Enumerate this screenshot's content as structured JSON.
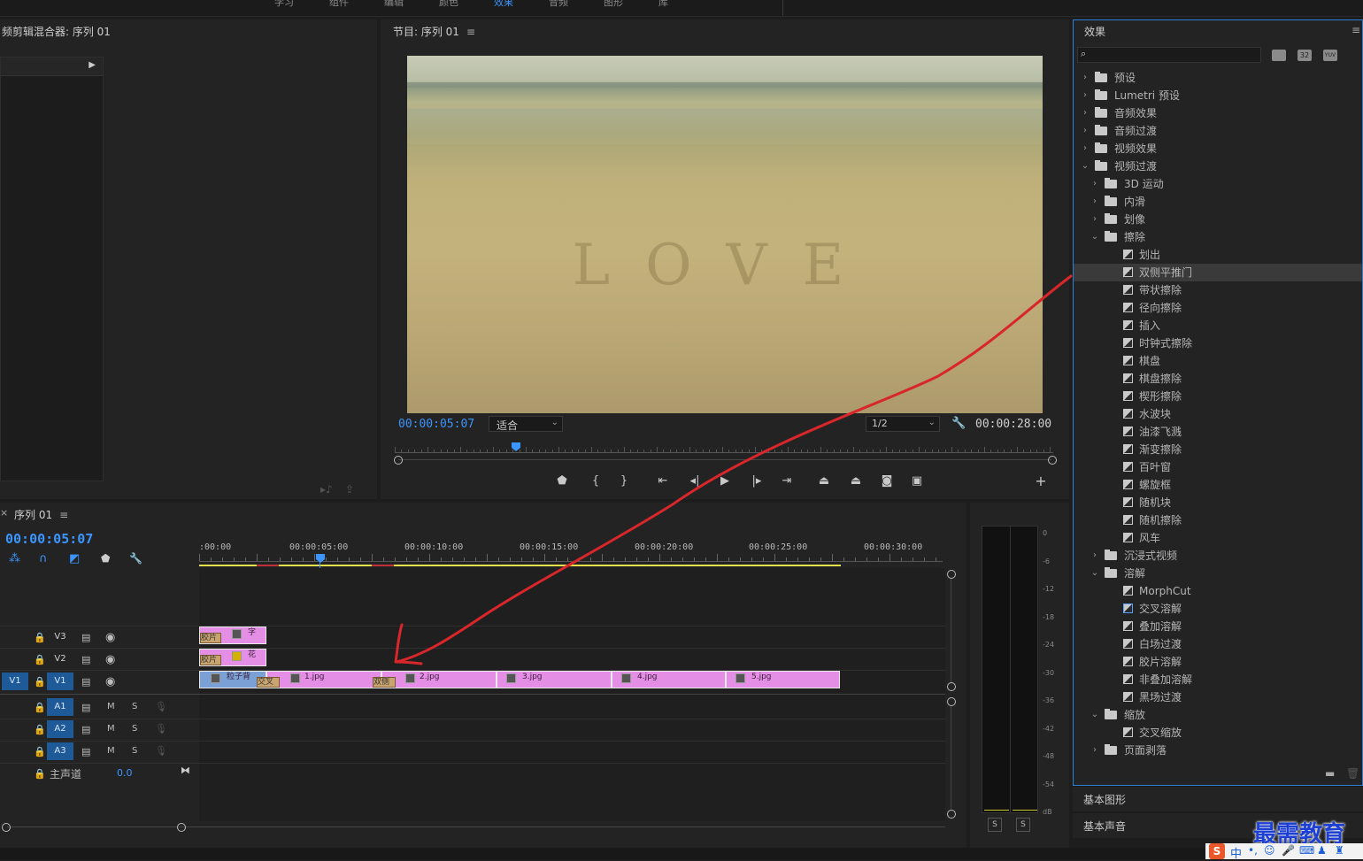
{
  "top_tabs": [
    "学习",
    "组件",
    "编辑",
    "颜色",
    "效果",
    "音频",
    "图形",
    "库"
  ],
  "left_panel": {
    "title": "频剪辑混合器: 序列 01"
  },
  "program": {
    "title": "节目: 序列 01",
    "menu_icon": "hamburger-icon",
    "timecode": "00:00:05:07",
    "fit_label": "适合",
    "resolution": "1/2",
    "duration": "00:00:28:00",
    "video_text": "LOVE"
  },
  "effects": {
    "title": "效果",
    "search_placeholder": "",
    "buttons": [
      "32",
      "YUV"
    ],
    "rows": [
      {
        "label": "预设",
        "level": 0,
        "type": "star-folder",
        "open": false
      },
      {
        "label": "Lumetri 预设",
        "level": 0,
        "type": "star-folder",
        "open": false
      },
      {
        "label": "音频效果",
        "level": 0,
        "type": "folder",
        "open": false
      },
      {
        "label": "音频过渡",
        "level": 0,
        "type": "folder",
        "open": false
      },
      {
        "label": "视频效果",
        "level": 0,
        "type": "folder",
        "open": false
      },
      {
        "label": "视频过渡",
        "level": 0,
        "type": "folder",
        "open": true
      },
      {
        "label": "3D 运动",
        "level": 1,
        "type": "folder",
        "open": false
      },
      {
        "label": "内滑",
        "level": 1,
        "type": "folder",
        "open": false
      },
      {
        "label": "划像",
        "level": 1,
        "type": "folder",
        "open": false
      },
      {
        "label": "擦除",
        "level": 1,
        "type": "folder",
        "open": true
      },
      {
        "label": "划出",
        "level": 2,
        "type": "item"
      },
      {
        "label": "双侧平推门",
        "level": 2,
        "type": "item",
        "selected": true
      },
      {
        "label": "带状擦除",
        "level": 2,
        "type": "item"
      },
      {
        "label": "径向擦除",
        "level": 2,
        "type": "item"
      },
      {
        "label": "插入",
        "level": 2,
        "type": "item"
      },
      {
        "label": "时钟式擦除",
        "level": 2,
        "type": "item"
      },
      {
        "label": "棋盘",
        "level": 2,
        "type": "item"
      },
      {
        "label": "棋盘擦除",
        "level": 2,
        "type": "item"
      },
      {
        "label": "楔形擦除",
        "level": 2,
        "type": "item"
      },
      {
        "label": "水波块",
        "level": 2,
        "type": "item"
      },
      {
        "label": "油漆飞溅",
        "level": 2,
        "type": "item"
      },
      {
        "label": "渐变擦除",
        "level": 2,
        "type": "item"
      },
      {
        "label": "百叶窗",
        "level": 2,
        "type": "item"
      },
      {
        "label": "螺旋框",
        "level": 2,
        "type": "item"
      },
      {
        "label": "随机块",
        "level": 2,
        "type": "item"
      },
      {
        "label": "随机擦除",
        "level": 2,
        "type": "item"
      },
      {
        "label": "风车",
        "level": 2,
        "type": "item"
      },
      {
        "label": "沉浸式视频",
        "level": 1,
        "type": "folder",
        "open": false
      },
      {
        "label": "溶解",
        "level": 1,
        "type": "folder",
        "open": true
      },
      {
        "label": "MorphCut",
        "level": 2,
        "type": "item"
      },
      {
        "label": "交叉溶解",
        "level": 2,
        "type": "item",
        "highlight": true
      },
      {
        "label": "叠加溶解",
        "level": 2,
        "type": "item"
      },
      {
        "label": "白场过渡",
        "level": 2,
        "type": "item"
      },
      {
        "label": "胶片溶解",
        "level": 2,
        "type": "item"
      },
      {
        "label": "非叠加溶解",
        "level": 2,
        "type": "item"
      },
      {
        "label": "黑场过渡",
        "level": 2,
        "type": "item"
      },
      {
        "label": "缩放",
        "level": 1,
        "type": "folder",
        "open": true
      },
      {
        "label": "交叉缩放",
        "level": 2,
        "type": "item"
      },
      {
        "label": "页面剥落",
        "level": 1,
        "type": "folder",
        "open": false
      }
    ]
  },
  "lower_panels": [
    "基本图形",
    "基本声音"
  ],
  "timeline": {
    "title": "序列 01",
    "timecode": "00:00:05:07",
    "ruler": [
      ":00:00",
      "00:00:05:00",
      "00:00:10:00",
      "00:00:15:00",
      "00:00:20:00",
      "00:00:25:00",
      "00:00:30:00"
    ],
    "video_tracks": [
      {
        "name": "V3",
        "src": ""
      },
      {
        "name": "V2",
        "src": ""
      },
      {
        "name": "V1",
        "src": "V1"
      }
    ],
    "audio_tracks": [
      {
        "name": "A1",
        "m": "M",
        "s": "S"
      },
      {
        "name": "A2",
        "m": "M",
        "s": "S"
      },
      {
        "name": "A3",
        "m": "M",
        "s": "S"
      }
    ],
    "master": {
      "label": "主声道",
      "value": "0.0"
    },
    "clips": {
      "v3": {
        "badge": "胶片",
        "name": "字"
      },
      "v2": {
        "badge": "胶片",
        "name": "花"
      },
      "v1": [
        {
          "name": "粒子背"
        },
        {
          "name": "1.jpg"
        },
        {
          "name": "2.jpg"
        },
        {
          "name": "3.jpg"
        },
        {
          "name": "4.jpg"
        },
        {
          "name": "5.jpg"
        }
      ],
      "transitions": [
        "交叉",
        "双侧"
      ]
    }
  },
  "meter": {
    "scale": [
      "0",
      "-6",
      "-12",
      "-18",
      "-24",
      "-30",
      "-36",
      "-42",
      "-48",
      "-54",
      "dB"
    ],
    "solo": [
      "S",
      "S"
    ]
  },
  "watermark": {
    "text": "最需教育"
  },
  "ime": {
    "label": "中"
  }
}
